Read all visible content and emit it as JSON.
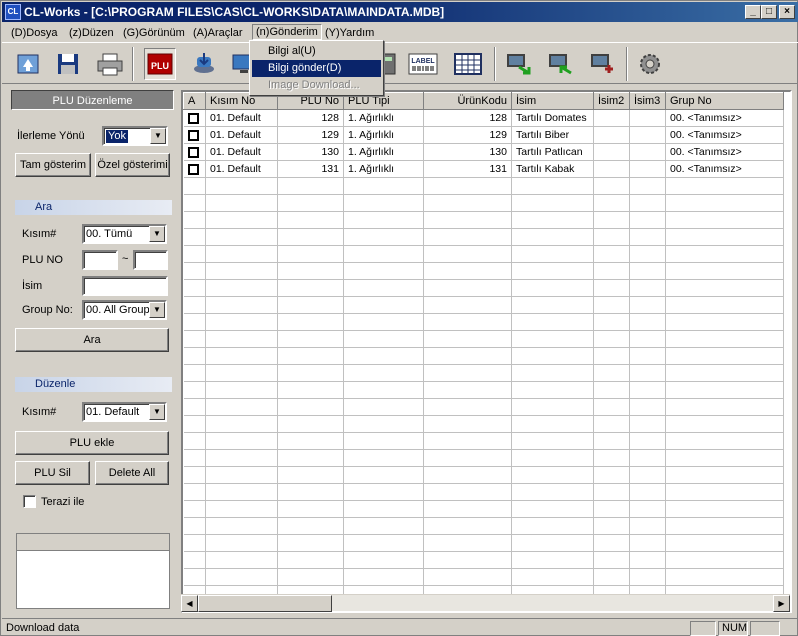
{
  "window": {
    "title": "CL-Works - [C:\\PROGRAM FILES\\CAS\\CL-WORKS\\DATA\\MAINDATA.MDB]",
    "app_icon": "CL",
    "controls": [
      "_",
      "□",
      "×"
    ]
  },
  "menu": [
    {
      "label": "(D)Dosya"
    },
    {
      "label": "(z)Düzen"
    },
    {
      "label": "(G)Görünüm"
    },
    {
      "label": "(A)Araçlar"
    },
    {
      "label": "(n)Gönderim"
    },
    {
      "label": "(Y)Yardım"
    }
  ],
  "dropdown": {
    "items": [
      {
        "label": "Bilgi al(U)",
        "state": "normal"
      },
      {
        "label": "Bilgi gönder(D)",
        "state": "highlighted"
      },
      {
        "label": "Image Download...",
        "state": "disabled"
      }
    ]
  },
  "toolbar": {
    "plu_label": "PLU",
    "label_label": "LABEL",
    "icons": [
      "open-icon",
      "save-icon",
      "print-icon",
      "plu-icon",
      "download-icon",
      "monitor-icon",
      "scale-icon",
      "label-icon",
      "table-icon",
      "export-icon",
      "import-icon",
      "transfer-icon",
      "settings-icon"
    ]
  },
  "left_panel": {
    "title": "PLU Düzenleme",
    "direction_label": "İlerleme Yönü",
    "direction_value": "Yok",
    "btn_full": "Tam gösterim",
    "btn_custom": "Özel gösterimi",
    "search_title": "Ara",
    "dept_label": "Kısım#",
    "dept_value": "00. Tümü",
    "plu_no_label": "PLU NO",
    "range_sep": "~",
    "name_label": "İsim",
    "group_label": "Group No:",
    "group_value": "00. All Group",
    "search_btn": "Ara",
    "edit_title": "Düzenle",
    "edit_dept_label": "Kısım#",
    "edit_dept_value": "01. Default",
    "add_btn": "PLU ekle",
    "delete_btn": "PLU Sil",
    "delete_all_btn": "Delete All",
    "scale_chk_label": "Terazi ile"
  },
  "grid": {
    "columns": [
      "A",
      "Kısım No",
      "PLU No",
      "PLU Tipi",
      "ÜrünKodu",
      "İsim",
      "İsim2",
      "İsim3",
      "Grup No"
    ],
    "rows": [
      {
        "dept": "01. Default",
        "plu": "128",
        "type": "1. Ağırlıklı",
        "code": "128",
        "name": "Tartılı Domates",
        "name2": "",
        "name3": "",
        "group": "00. <Tanımsız>"
      },
      {
        "dept": "01. Default",
        "plu": "129",
        "type": "1. Ağırlıklı",
        "code": "129",
        "name": "Tartılı Biber",
        "name2": "",
        "name3": "",
        "group": "00. <Tanımsız>"
      },
      {
        "dept": "01. Default",
        "plu": "130",
        "type": "1. Ağırlıklı",
        "code": "130",
        "name": "Tartılı Patlıcan",
        "name2": "",
        "name3": "",
        "group": "00. <Tanımsız>"
      },
      {
        "dept": "01. Default",
        "plu": "131",
        "type": "1. Ağırlıklı",
        "code": "131",
        "name": "Tartılı Kabak",
        "name2": "",
        "name3": "",
        "group": "00. <Tanımsız>"
      }
    ]
  },
  "status": {
    "text": "Download data",
    "num": "NUM"
  }
}
